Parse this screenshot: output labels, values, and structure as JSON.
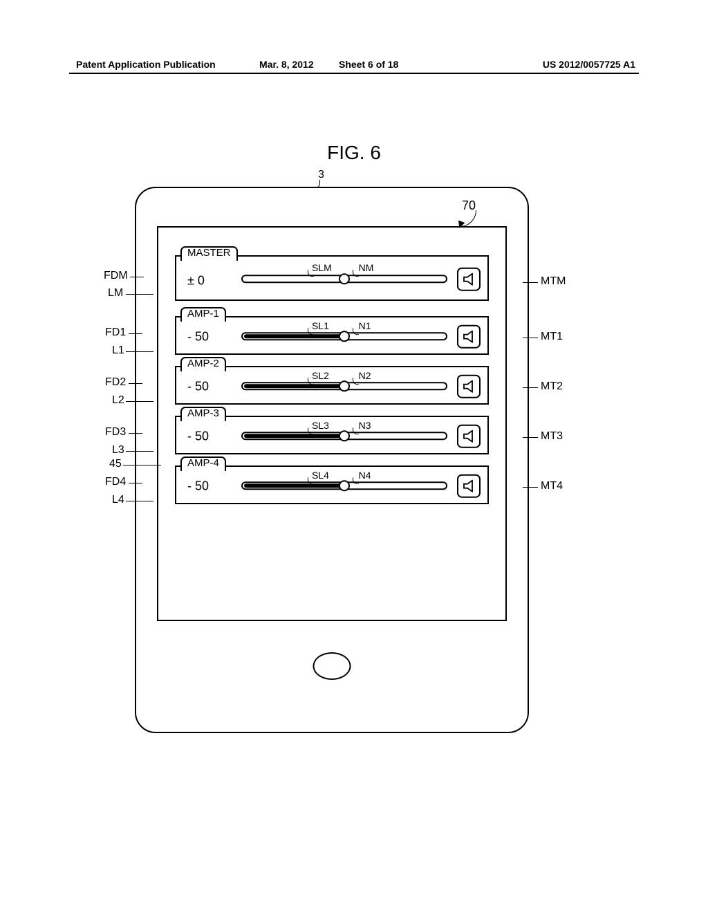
{
  "header": {
    "left": "Patent Application Publication",
    "date": "Mar. 8, 2012",
    "sheet": "Sheet 6 of 18",
    "pubno": "US 2012/0057725 A1"
  },
  "figure_title": "FIG. 6",
  "device_ref": "3",
  "screen_ref": "70",
  "rows": {
    "master": {
      "tab": "MASTER",
      "level": "± 0",
      "sl_label": "SLM",
      "n_label": "NM",
      "fill_percent": 0,
      "knob_percent": 50,
      "left_labels": {
        "fd": "FDM",
        "l": "LM"
      },
      "right_label": "MTM"
    },
    "r1": {
      "tab": "AMP-1",
      "level": "- 50",
      "sl_label": "SL1",
      "n_label": "N1",
      "fill_percent": 50,
      "knob_percent": 50,
      "left_labels": {
        "fd": "FD1",
        "l": "L1"
      },
      "right_label": "MT1"
    },
    "r2": {
      "tab": "AMP-2",
      "level": "- 50",
      "sl_label": "SL2",
      "n_label": "N2",
      "fill_percent": 50,
      "knob_percent": 50,
      "left_labels": {
        "fd": "FD2",
        "l": "L2"
      },
      "right_label": "MT2"
    },
    "r3": {
      "tab": "AMP-3",
      "level": "- 50",
      "sl_label": "SL3",
      "n_label": "N3",
      "fill_percent": 50,
      "knob_percent": 50,
      "left_labels": {
        "fd": "FD3",
        "l": "L3"
      },
      "right_label": "MT3"
    },
    "r4": {
      "tab": "AMP-4",
      "level": "- 50",
      "sl_label": "SL4",
      "n_label": "N4",
      "fill_percent": 50,
      "knob_percent": 50,
      "left_labels": {
        "fd": "FD4",
        "l": "L4"
      },
      "right_label": "MT4"
    }
  },
  "extra_label_45": "45"
}
